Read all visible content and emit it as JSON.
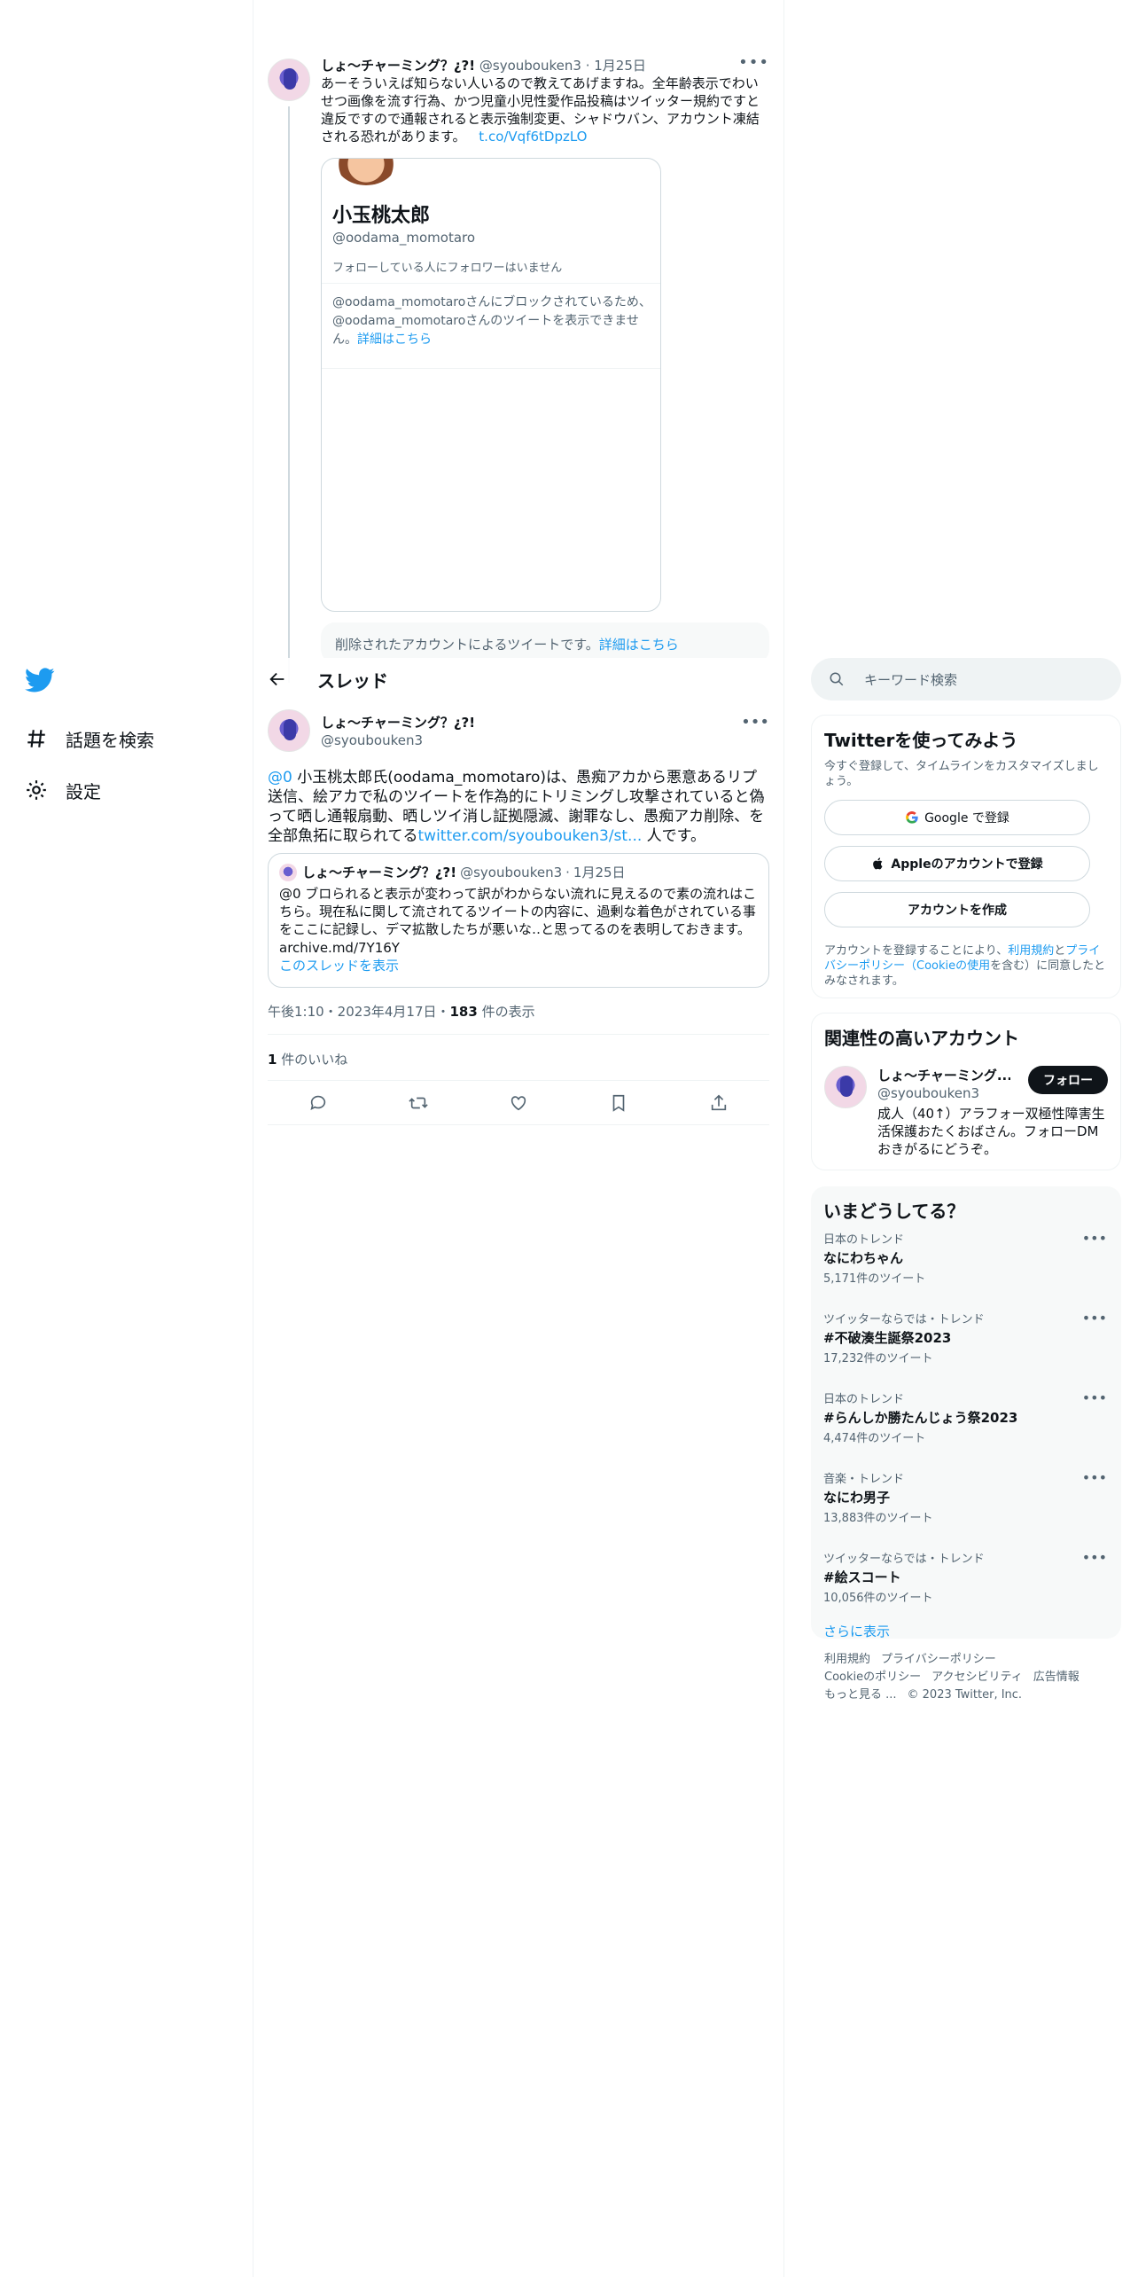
{
  "nav": {
    "items": [
      {
        "label": "話題を検索",
        "icon": "hashtag-icon"
      },
      {
        "label": "設定",
        "icon": "gear-icon"
      }
    ]
  },
  "prev_tweet": {
    "name": "しょ〜チャーミング？¿?!",
    "handle": "@syoubouken3",
    "date": "1月25日",
    "text": "あーそういえば知らない人いるので教えてあげますね。全年齢表示でわいせつ画像を流す行為、かつ児童小児性愛作品投稿はツイッター規約ですと違反ですので通報されると表示強制変更、シャドウバン、アカウント凍結される恐れがあります。",
    "link": "t.co/Vqf6tDpzLO",
    "card": {
      "name": "小玉桃太郎",
      "handle": "@oodama_momotaro",
      "follow_info": "フォローしている人にフォロワーはいません",
      "blocked_text": "@oodama_momotaroさんにブロックされているため、@oodama_momotaroさんのツイートを表示できません。",
      "blocked_link": "詳細はこちら"
    }
  },
  "deleted": {
    "text": "削除されたアカウントによるツイートです。",
    "link": "詳細はこちら"
  },
  "header": {
    "title": "スレッド"
  },
  "main_tweet": {
    "name": "しょ〜チャーミング？¿?!",
    "handle": "@syoubouken3",
    "mention": "@0",
    "text": " 小玉桃太郎氏(oodama_momotaro)は、愚痴アカから悪意あるリプ送信、絵アカで私のツイートを作為的にトリミングし攻撃されていると偽って晒し通報扇動、晒しツイ消し証拠隠滅、謝罪なし、愚痴アカ削除、を全部魚拓に取られてる",
    "link": "twitter.com/syoubouken3/st...",
    "text_end": " 人です。"
  },
  "quote": {
    "name": "しょ〜チャーミング？¿?!",
    "handle": "@syoubouken3",
    "date": "1月25日",
    "text": "@0 ブロられると表示が変わって訳がわからない流れに見えるので素の流れはこちら。現在私に関して流されてるツイートの内容に、過剰な着色がされている事をここに記録し、デマ拡散したちが悪いな‥と思ってるのを表明しておきます。",
    "link_text": "archive.md/7Y16Y",
    "show_thread": "このスレッドを表示"
  },
  "meta": {
    "time": "午後1:10・2023年4月17日・",
    "views": "183",
    "views_label": " 件の表示"
  },
  "likes": {
    "count": "1",
    "label": " 件のいいね"
  },
  "search": {
    "placeholder": "キーワード検索"
  },
  "signup": {
    "title": "Twitterを使ってみよう",
    "sub": "今すぐ登録して、タイムラインをカスタマイズしましょう。",
    "google": "Google で登録",
    "apple": "Appleのアカウントで登録",
    "create": "アカウントを作成",
    "legal_pre": "アカウントを登録することにより、",
    "legal_tos": "利用規約",
    "legal_and": "と",
    "legal_pp": "プライバシーポリシー（Cookieの使用",
    "legal_post": "を含む）に同意したとみなされます。"
  },
  "related": {
    "title": "関連性の高いアカウント",
    "name": "しょ〜チャーミング...",
    "handle": "@syoubouken3",
    "bio": "成人（40↑）アラフォー双極性障害生活保護おたくおばさん。フォローDMおきがるにどうぞ。",
    "follow": "フォロー"
  },
  "trends": {
    "title": "いまどうしてる？",
    "items": [
      {
        "cat": "日本のトレンド",
        "name": "なにわちゃん",
        "count": "5,171件のツイート"
      },
      {
        "cat": "ツイッターならでは・トレンド",
        "name": "#不破湊生誕祭2023",
        "count": "17,232件のツイート"
      },
      {
        "cat": "日本のトレンド",
        "name": "#らんしか勝たんじょう祭2023",
        "count": "4,474件のツイート"
      },
      {
        "cat": "音楽・トレンド",
        "name": "なにわ男子",
        "count": "13,883件のツイート"
      },
      {
        "cat": "ツイッターならでは・トレンド",
        "name": "#絵スコート",
        "count": "10,056件のツイート"
      }
    ],
    "show_more": "さらに表示"
  },
  "footer": {
    "tos": "利用規約",
    "privacy": "プライバシーポリシー",
    "cookie": "Cookieのポリシー",
    "access": "アクセシビリティ",
    "ads": "広告情報",
    "more": "もっと見る ...",
    "copy": "© 2023 Twitter, Inc."
  },
  "colors": {
    "accent": "#1d9bf0",
    "text": "#0f1419",
    "muted": "#536471"
  }
}
